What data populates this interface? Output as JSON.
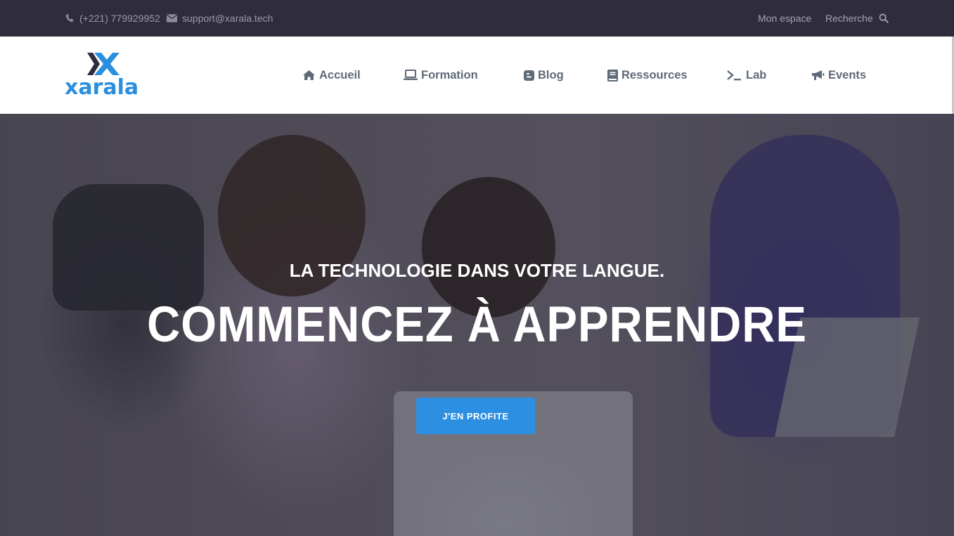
{
  "topbar": {
    "phone": "(+221) 779929952",
    "email": "support@xarala.tech",
    "my_space": "Mon espace",
    "search": "Recherche",
    "phone_icon": "phone-icon",
    "email_icon": "envelope-icon",
    "search_icon": "search-icon"
  },
  "brand": {
    "name": "xarala",
    "color": "#2b8fe0",
    "icon": "xarala-x-logo"
  },
  "nav": {
    "items": [
      {
        "label": "Accueil",
        "icon": "home-icon"
      },
      {
        "label": "Formation",
        "icon": "laptop-icon"
      },
      {
        "label": "Blog",
        "icon": "blog-icon"
      },
      {
        "label": "Ressources",
        "icon": "book-icon"
      },
      {
        "label": "Lab",
        "icon": "terminal-icon"
      },
      {
        "label": "Events",
        "icon": "bullhorn-icon"
      }
    ],
    "text_color": "#5f6a78"
  },
  "hero": {
    "tagline": "LA TECHNOLOGIE DANS VOTRE LANGUE.",
    "headline": "COMMENCEZ À APPRENDRE",
    "cta_label": "J'EN PROFITE",
    "cta_color": "#2d8fe2"
  },
  "colors": {
    "topbar_bg": "#2f2d3c",
    "accent": "#2d8fe2"
  }
}
